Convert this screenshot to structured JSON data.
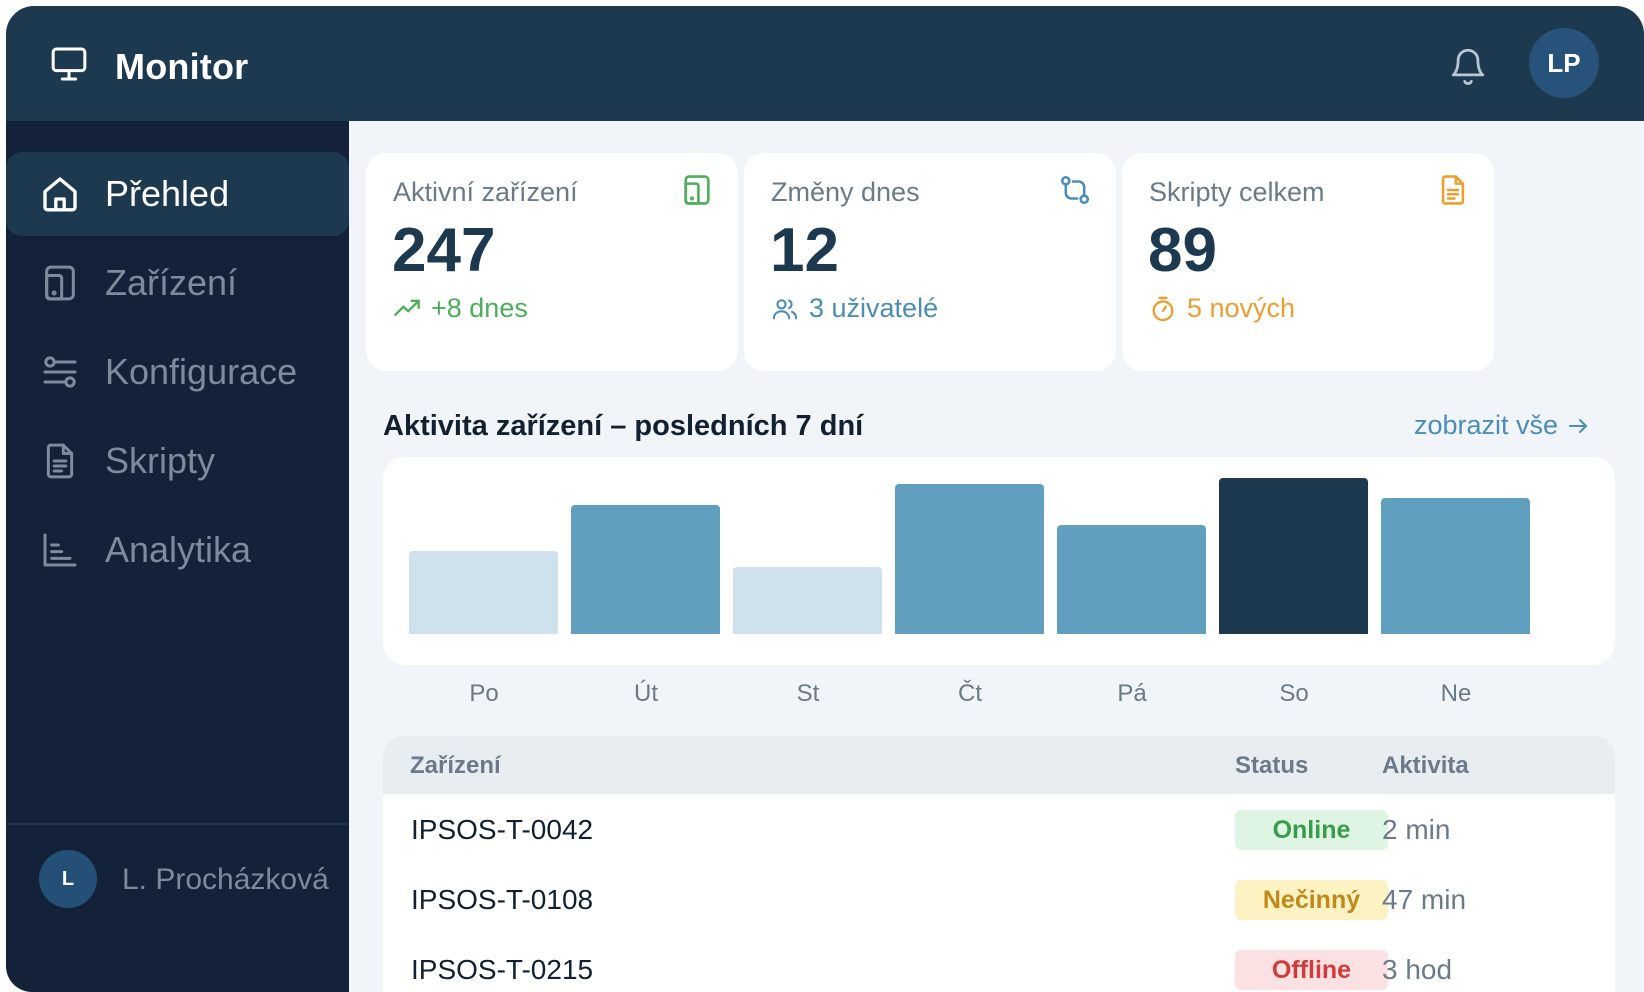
{
  "header": {
    "title": "Monitor",
    "avatar": "LP",
    "icons": {
      "brand": "monitor-icon",
      "notifications": "bell-icon"
    }
  },
  "sidebar": {
    "items": [
      {
        "label": "Přehled",
        "icon": "home-icon",
        "active": true
      },
      {
        "label": "Zařízení",
        "icon": "tablet-icon",
        "active": false
      },
      {
        "label": "Konfigurace",
        "icon": "sliders-icon",
        "active": false
      },
      {
        "label": "Skripty",
        "icon": "document-icon",
        "active": false
      },
      {
        "label": "Analytika",
        "icon": "bar-chart-icon",
        "active": false
      }
    ],
    "user": {
      "initial": "L",
      "name": "L. Procházková"
    }
  },
  "cards": [
    {
      "label": "Aktivní zařízení",
      "value": "247",
      "sub": "+8 dnes",
      "icon": "tablet-icon",
      "sub_icon": "trend-up-icon",
      "accent": "#4cae5b",
      "sub_color": "#4cae5b"
    },
    {
      "label": "Změny dnes",
      "value": "12",
      "sub": "3 uživatelé",
      "icon": "git-compare-icon",
      "sub_icon": "users-icon",
      "accent": "#4b8db5",
      "sub_color": "#4b8db5"
    },
    {
      "label": "Skripty celkem",
      "value": "89",
      "sub": "5 nových",
      "icon": "document-icon",
      "sub_icon": "timer-icon",
      "accent": "#e9a030",
      "sub_color": "#e9a030"
    }
  ],
  "activity": {
    "title": "Aktivita zařízení – posledních 7 dní",
    "view_all": "zobrazit vše"
  },
  "chart_data": {
    "type": "bar",
    "categories": [
      "Po",
      "Út",
      "St",
      "Čt",
      "Pá",
      "So",
      "Ne"
    ],
    "values": [
      53,
      83,
      43,
      96,
      70,
      100,
      87
    ],
    "ylim": [
      0,
      100
    ],
    "grid": false,
    "colors": [
      "#cfe1ec",
      "#619fbf",
      "#cfe1ec",
      "#619fbf",
      "#619fbf",
      "#1d3950",
      "#619fbf"
    ]
  },
  "table": {
    "headers": {
      "device": "Zařízení",
      "status": "Status",
      "activity": "Aktivita"
    },
    "rows": [
      {
        "device": "IPSOS-T-0042",
        "status": "Online",
        "activity": "2 min",
        "status_bg": "#dff5e3",
        "status_fg": "#3b9a4c"
      },
      {
        "device": "IPSOS-T-0108",
        "status": "Nečinný",
        "activity": "47 min",
        "status_bg": "#fcf2c2",
        "status_fg": "#c0891a"
      },
      {
        "device": "IPSOS-T-0215",
        "status": "Offline",
        "activity": "3 hod",
        "status_bg": "#fbe1e1",
        "status_fg": "#d13b3b"
      }
    ]
  }
}
